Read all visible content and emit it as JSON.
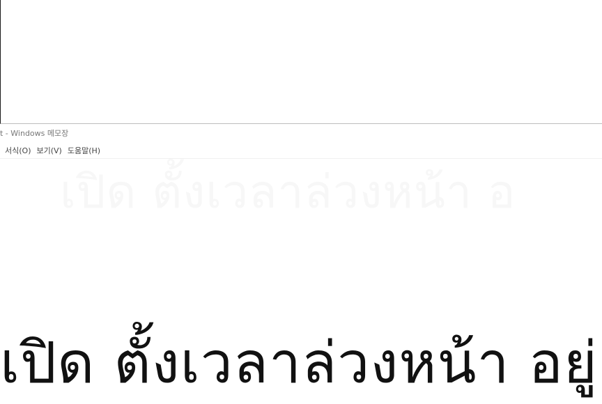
{
  "notepad": {
    "title": "t - Windows 메모장",
    "menu": [
      {
        "label": "서식(O)"
      },
      {
        "label": "보기(V)"
      },
      {
        "label": "도움말(H)"
      }
    ],
    "content_text": "เปิด ตั้งเวลาล่วงหน้า อยู่",
    "ghost_text": "เปิด ตั้งเวลาล่วงหน้า อ"
  }
}
